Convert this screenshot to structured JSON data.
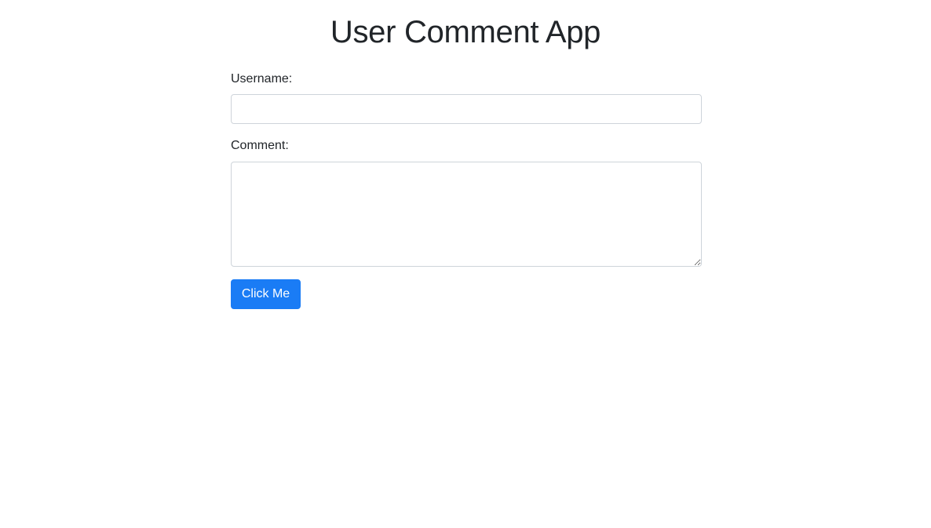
{
  "header": {
    "title": "User Comment App"
  },
  "form": {
    "username_label": "Username:",
    "username_value": "",
    "username_placeholder": "",
    "comment_label": "Comment:",
    "comment_value": "",
    "comment_placeholder": "",
    "submit_label": "Click Me"
  },
  "colors": {
    "primary": "#1a7cf5",
    "text": "#212529",
    "border": "#ced4da",
    "background": "#ffffff"
  }
}
